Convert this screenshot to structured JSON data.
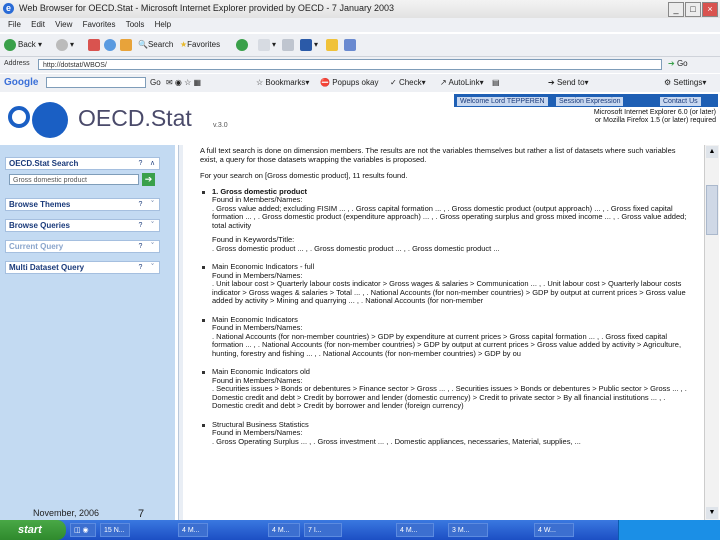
{
  "window": {
    "title": "Web Browser for OECD.Stat - Microsoft Internet Explorer provided by OECD - 7 January 2003"
  },
  "menu": [
    "File",
    "Edit",
    "View",
    "Favorites",
    "Tools",
    "Help"
  ],
  "toolbar": {
    "back": "Back",
    "search": "Search",
    "favorites": "Favorites"
  },
  "address": {
    "label": "Address",
    "value": "http://dotstat/WBOS/",
    "go": "Go"
  },
  "googlebar": {
    "logo": "Google",
    "go": "Go",
    "bookmarks": "Bookmarks",
    "popups": "Popups okay",
    "check": "Check",
    "autolink": "AutoLink",
    "sendto": "Send to",
    "settings": "Settings"
  },
  "header": {
    "logo": "OECD.Stat",
    "version": "v.3.0",
    "links": [
      "Welcome Lord TEPPEREN",
      "Session Expression",
      "Contact Us"
    ],
    "notice": [
      "Microsoft Internet Explorer 6.0 (or later)",
      "or Mozilla Firefox 1.5 (or later) required"
    ]
  },
  "sidebar": {
    "panels": [
      "OECD.Stat Search",
      "Browse Themes",
      "Browse Queries",
      "Current Query",
      "Multi Dataset Query"
    ],
    "search_value": "Gross domestic product",
    "date": "November, 2006",
    "page": "7"
  },
  "content": {
    "intro": "A full text search is done on dimension members. The results are not the variables themselves but rather a list of datasets where such variables exist, a query for those datasets wrapping the variables is proposed.",
    "summary": "For your search on [Gross domestic product], 11 results found.",
    "results": [
      {
        "title": "1. Gross domestic product",
        "found_label": "Found in Members/Names:",
        "text": ". Gross value added; excluding FISIM ... , . Gross capital formation ... , . Gross domestic product (output approach) ... , . Gross fixed capital formation ... , . Gross domestic product (expenditure approach) ... , . Gross operating surplus and gross mixed income ... , . Gross value added; total activity",
        "found_label2": "Found in Keywords/Title:",
        "text2": ". Gross domestic product ... , . Gross domestic product ... , . Gross domestic product ..."
      },
      {
        "title": "Main Economic Indicators - full",
        "found_label": "Found in Members/Names:",
        "text": ". Unit labour cost > Quarterly labour costs indicator > Gross wages & salaries > Communication ... , . Unit labour cost > Quarterly labour costs indicator > Gross wages & salaries > Total ... , . National Accounts (for non-member countries) > GDP by output at current prices > Gross value added by activity > Mining and quarrying ... , . National Accounts (for non-member"
      },
      {
        "title": "Main Economic Indicators",
        "found_label": "Found in Members/Names:",
        "text": ". National Accounts (for non-member countries) > GDP by expenditure at current prices > Gross capital formation ... , . Gross fixed capital formation ... , . National Accounts (for non-member countries) > GDP by output at current prices > Gross value added by activity > Agriculture, hunting, forestry and fishing ... , . National Accounts (for non-member countries) > GDP by ou"
      },
      {
        "title": "Main Economic Indicators old",
        "found_label": "Found in Members/Names:",
        "text": ". Securities issues > Bonds or debentures > Finance sector > Gross ... , . Securities issues > Bonds or debentures > Public sector > Gross ... , . Domestic credit and debt > Credit by borrower and lender (domestic currency) > Credit to private sector > By all financial institutions ... , . Domestic credit and debt > Credit by borrower and lender (foreign currency)"
      },
      {
        "title": "Structural Business Statistics",
        "found_label": "Found in Members/Names:",
        "text": ". Gross Operating Surplus ... , . Gross investment ... , . Domestic appliances, necessaries, Material, supplies, ..."
      }
    ]
  },
  "taskbar": {
    "start": "start",
    "tasks": [
      "15 N...",
      "4 M...",
      "4 M...",
      "7 I...",
      "4 M...",
      "3 M...",
      "4 W..."
    ]
  }
}
